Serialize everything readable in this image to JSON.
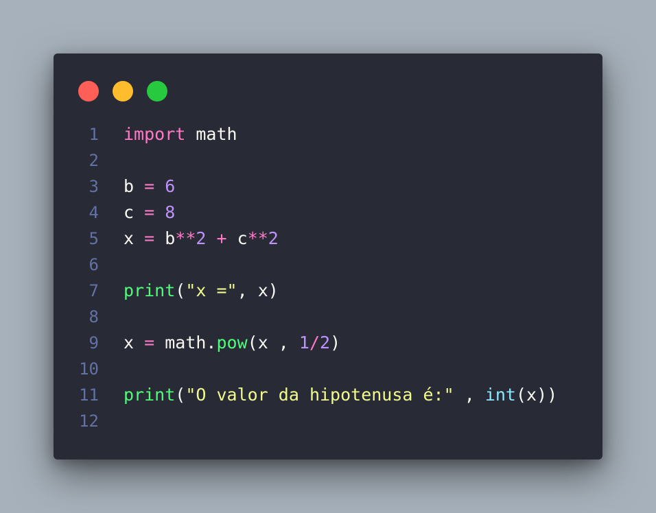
{
  "window": {
    "buttons": [
      {
        "name": "close",
        "color": "#ff5f56"
      },
      {
        "name": "minimize",
        "color": "#ffbd2e"
      },
      {
        "name": "maximize",
        "color": "#27c93f"
      }
    ]
  },
  "theme": {
    "background": "#a7b1bb",
    "editor_background": "#282a36",
    "keyword": "#ff79c6",
    "number": "#bd93f9",
    "function": "#50fa7b",
    "string": "#f1fa8c",
    "builtin": "#8be9fd",
    "text": "#f8f8f2",
    "line_number": "#6272a4"
  },
  "code": {
    "language": "python",
    "lines": [
      {
        "num": "1",
        "tokens": [
          {
            "t": "import",
            "k": "kw"
          },
          {
            "t": " math",
            "k": "id"
          }
        ]
      },
      {
        "num": "2",
        "tokens": []
      },
      {
        "num": "3",
        "tokens": [
          {
            "t": "b ",
            "k": "id"
          },
          {
            "t": "=",
            "k": "op"
          },
          {
            "t": " ",
            "k": "id"
          },
          {
            "t": "6",
            "k": "num"
          }
        ]
      },
      {
        "num": "4",
        "tokens": [
          {
            "t": "c ",
            "k": "id"
          },
          {
            "t": "=",
            "k": "op"
          },
          {
            "t": " ",
            "k": "id"
          },
          {
            "t": "8",
            "k": "num"
          }
        ]
      },
      {
        "num": "5",
        "tokens": [
          {
            "t": "x ",
            "k": "id"
          },
          {
            "t": "=",
            "k": "op"
          },
          {
            "t": " b",
            "k": "id"
          },
          {
            "t": "**",
            "k": "op"
          },
          {
            "t": "2",
            "k": "num"
          },
          {
            "t": " ",
            "k": "id"
          },
          {
            "t": "+",
            "k": "op"
          },
          {
            "t": " c",
            "k": "id"
          },
          {
            "t": "**",
            "k": "op"
          },
          {
            "t": "2",
            "k": "num"
          }
        ]
      },
      {
        "num": "6",
        "tokens": []
      },
      {
        "num": "7",
        "tokens": [
          {
            "t": "print",
            "k": "fn"
          },
          {
            "t": "(",
            "k": "punct"
          },
          {
            "t": "\"x =\"",
            "k": "str"
          },
          {
            "t": ", x)",
            "k": "punct"
          }
        ]
      },
      {
        "num": "8",
        "tokens": []
      },
      {
        "num": "9",
        "tokens": [
          {
            "t": "x ",
            "k": "id"
          },
          {
            "t": "=",
            "k": "op"
          },
          {
            "t": " math.",
            "k": "id"
          },
          {
            "t": "pow",
            "k": "fn"
          },
          {
            "t": "(x , ",
            "k": "punct"
          },
          {
            "t": "1",
            "k": "num"
          },
          {
            "t": "/",
            "k": "op"
          },
          {
            "t": "2",
            "k": "num"
          },
          {
            "t": ")",
            "k": "punct"
          }
        ]
      },
      {
        "num": "10",
        "tokens": []
      },
      {
        "num": "11",
        "tokens": [
          {
            "t": "print",
            "k": "fn"
          },
          {
            "t": "(",
            "k": "punct"
          },
          {
            "t": "\"O valor da hipotenusa é:\"",
            "k": "str"
          },
          {
            "t": " , ",
            "k": "punct"
          },
          {
            "t": "int",
            "k": "builtin"
          },
          {
            "t": "(x))",
            "k": "punct"
          }
        ]
      },
      {
        "num": "12",
        "tokens": []
      }
    ]
  }
}
